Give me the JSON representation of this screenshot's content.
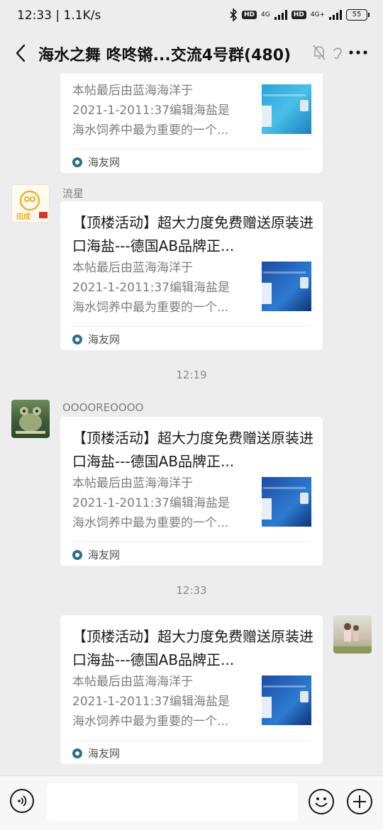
{
  "status_bar": {
    "time": "12:33",
    "speed": "1.1K/s",
    "hd1": "HD",
    "net1": "4G",
    "hd2": "HD",
    "net2": "4G+",
    "battery": "55"
  },
  "header": {
    "title": "海水之舞 咚咚锵...交流4号群(480)"
  },
  "messages": [
    {
      "desc_lines": [
        "本帖最后由蓝海海洋于",
        "2021-1-2011:37编辑海盐是",
        "海水饲养中最为重要的一个..."
      ],
      "source": "海友网"
    },
    {
      "sender": "流星",
      "title": "【顶楼活动】超大力度免费赠送原装进口海盐---德国AB品牌正...",
      "desc_lines": [
        "本帖最后由蓝海海洋于",
        "2021-1-2011:37编辑海盐是",
        "海水饲养中最为重要的一个..."
      ],
      "source": "海友网"
    },
    {
      "timestamp": "12:19"
    },
    {
      "sender": "OOOOREOOOO",
      "title": "【顶楼活动】超大力度免费赠送原装进口海盐---德国AB品牌正...",
      "desc_lines": [
        "本帖最后由蓝海海洋于",
        "2021-1-2011:37编辑海盐是",
        "海水饲养中最为重要的一个..."
      ],
      "source": "海友网"
    },
    {
      "timestamp": "12:33"
    },
    {
      "title": "【顶楼活动】超大力度免费赠送原装进口海盐---德国AB品牌正...",
      "desc_lines": [
        "本帖最后由蓝海海洋于",
        "2021-1-2011:37编辑海盐是",
        "海水饲养中最为重要的一个..."
      ],
      "source": "海友网"
    }
  ],
  "avatar_badge": "田成",
  "icons": {
    "back": "back-arrow-icon",
    "mute": "mute-bell-icon",
    "earpiece": "earpiece-icon",
    "more": "more-dots-icon",
    "voice": "voice-icon",
    "emoji": "emoji-icon",
    "plus": "plus-icon"
  }
}
